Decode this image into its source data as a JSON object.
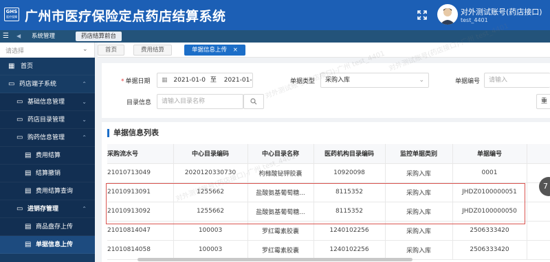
{
  "header": {
    "logo_text": "GHS",
    "logo_sub": "医疗保障",
    "title": "广州市医疗保险定点药店结算系统",
    "user_name": "对外测试账号(药店接口)",
    "user_id": "test_4401",
    "bg_color": "#1c5fb5"
  },
  "nav": {
    "system": "系统管理",
    "current": "药店结算前台"
  },
  "sidebar": {
    "select_placeholder": "请选择",
    "items": [
      {
        "label": "首页",
        "icon": "grid-icon"
      },
      {
        "label": "药店端子系统",
        "icon": "folder-icon"
      },
      {
        "label": "基础信息管理",
        "icon": "folder-icon"
      },
      {
        "label": "药店目录管理",
        "icon": "folder-icon"
      },
      {
        "label": "购药信息管理",
        "icon": "folder-icon"
      },
      {
        "label": "费用结算",
        "icon": "doc-icon"
      },
      {
        "label": "结算撤销",
        "icon": "doc-icon"
      },
      {
        "label": "费用结算查询",
        "icon": "doc-icon"
      },
      {
        "label": "进销存管理",
        "icon": "folder-icon"
      },
      {
        "label": "商品盘存上传",
        "icon": "doc-icon"
      },
      {
        "label": "单据信息上传",
        "icon": "doc-icon"
      }
    ]
  },
  "tabs": [
    {
      "label": "首页"
    },
    {
      "label": "费用结算"
    },
    {
      "label": "单据信息上传",
      "close": "×"
    }
  ],
  "form": {
    "date_label": "单据日期",
    "date_start": "2021-01-0",
    "date_sep": "至",
    "date_end": "2021-01-0",
    "type_label": "单据类型",
    "type_value": "采购入库",
    "code_label": "单据编号",
    "code_placeholder": "请输入",
    "catalog_label": "目录信息",
    "catalog_placeholder": "请输入目录名称",
    "reset_label": "重"
  },
  "list": {
    "title": "单据信息列表",
    "columns": [
      "采购流水号",
      "中心目录编码",
      "中心目录名称",
      "医药机构目录编码",
      "监控单据类别",
      "单据编号"
    ],
    "rows": [
      [
        "21010713049",
        "2020120330730",
        "枸橼酸铋钾胶囊",
        "10920098",
        "采购入库",
        "0001"
      ],
      [
        "21010913091",
        "1255662",
        "盐酸氨基葡萄糖...",
        "8115352",
        "采购入库",
        "JHDZ0100000051"
      ],
      [
        "21010913092",
        "1255662",
        "盐酸氨基葡萄糖...",
        "8115352",
        "采购入库",
        "JHDZ0100000050"
      ],
      [
        "21010814047",
        "100003",
        "罗红霉素胶囊",
        "1240102256",
        "采购入库",
        "2506333420"
      ],
      [
        "21010814058",
        "100003",
        "罗红霉素胶囊",
        "1240102256",
        "采购入库",
        "2506333420"
      ]
    ]
  },
  "watermark": "对外测试账号(药店接口)-广州 test_4401"
}
